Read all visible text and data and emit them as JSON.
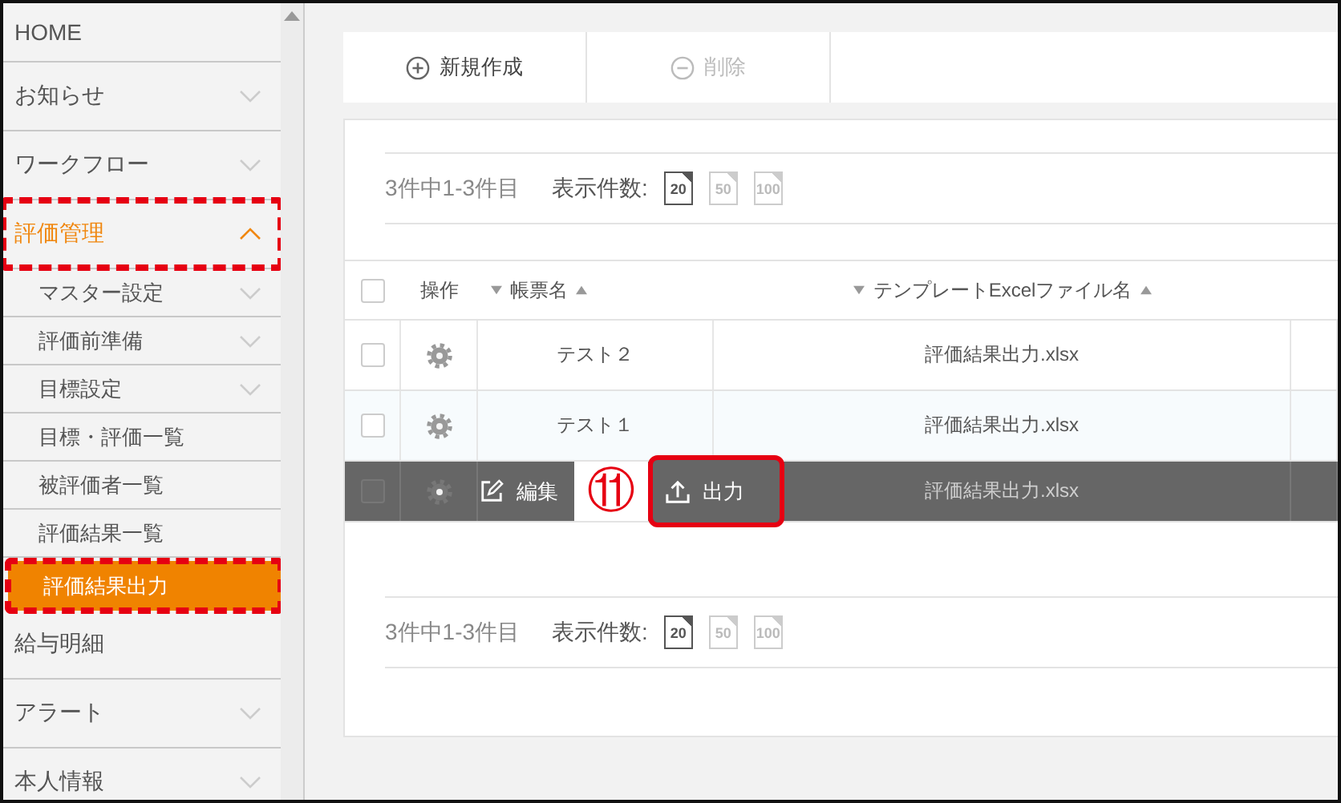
{
  "sidebar": {
    "items": [
      {
        "label": "HOME",
        "kind": "link",
        "selected": false,
        "annotated": false
      },
      {
        "label": "お知らせ",
        "kind": "group",
        "expanded": false,
        "selected": false,
        "annotated": false
      },
      {
        "label": "ワークフロー",
        "kind": "group",
        "expanded": false,
        "selected": false,
        "annotated": false
      },
      {
        "label": "評価管理",
        "kind": "group",
        "expanded": true,
        "selected": false,
        "annotated": true,
        "children": [
          {
            "label": "マスター設定",
            "kind": "group",
            "expanded": false,
            "selected": false,
            "annotated": false
          },
          {
            "label": "評価前準備",
            "kind": "group",
            "expanded": false,
            "selected": false,
            "annotated": false
          },
          {
            "label": "目標設定",
            "kind": "group",
            "expanded": false,
            "selected": false,
            "annotated": false
          },
          {
            "label": "目標・評価一覧",
            "kind": "link",
            "selected": false,
            "annotated": false
          },
          {
            "label": "被評価者一覧",
            "kind": "link",
            "selected": false,
            "annotated": false
          },
          {
            "label": "評価結果一覧",
            "kind": "link",
            "selected": false,
            "annotated": false
          },
          {
            "label": "評価結果出力",
            "kind": "link",
            "selected": true,
            "annotated": true
          }
        ]
      },
      {
        "label": "給与明細",
        "kind": "link",
        "selected": false,
        "annotated": false
      },
      {
        "label": "アラート",
        "kind": "group",
        "expanded": false,
        "selected": false,
        "annotated": false
      },
      {
        "label": "本人情報",
        "kind": "group",
        "expanded": false,
        "selected": false,
        "annotated": false
      }
    ]
  },
  "toolbar": {
    "buttons": [
      {
        "label": "新規作成",
        "kind": "add",
        "disabled": false
      },
      {
        "label": "削除",
        "kind": "delete",
        "disabled": true
      }
    ]
  },
  "pager_top": {
    "range": "3件中1-3件目",
    "page_size_label": "表示件数:",
    "page_sizes": [
      {
        "label": "20",
        "selected": true
      },
      {
        "label": "50",
        "selected": false
      },
      {
        "label": "100",
        "selected": false
      }
    ]
  },
  "table": {
    "select_all_checked": false,
    "columns": [
      "操作",
      "帳票名",
      "テンプレートExcelファイル名"
    ],
    "rows": [
      {
        "checked": false,
        "name": "テスト２",
        "file": "評価結果出力.xlsx",
        "hovered": false
      },
      {
        "checked": false,
        "name": "テスト１",
        "file": "評価結果出力.xlsx",
        "hovered": false
      },
      {
        "checked": false,
        "file": "評価結果出力.xlsx",
        "hovered": true
      }
    ],
    "row_actions": {
      "callout": "⑪",
      "buttons": [
        {
          "label": "編集",
          "kind": "edit",
          "annotated": false
        },
        {
          "label": "出力",
          "kind": "export",
          "annotated": true
        }
      ]
    }
  },
  "pager_bottom": {
    "range": "3件中1-3件目",
    "page_size_label": "表示件数:",
    "page_sizes": [
      {
        "label": "20",
        "selected": true
      },
      {
        "label": "50",
        "selected": false
      },
      {
        "label": "100",
        "selected": false
      }
    ]
  }
}
